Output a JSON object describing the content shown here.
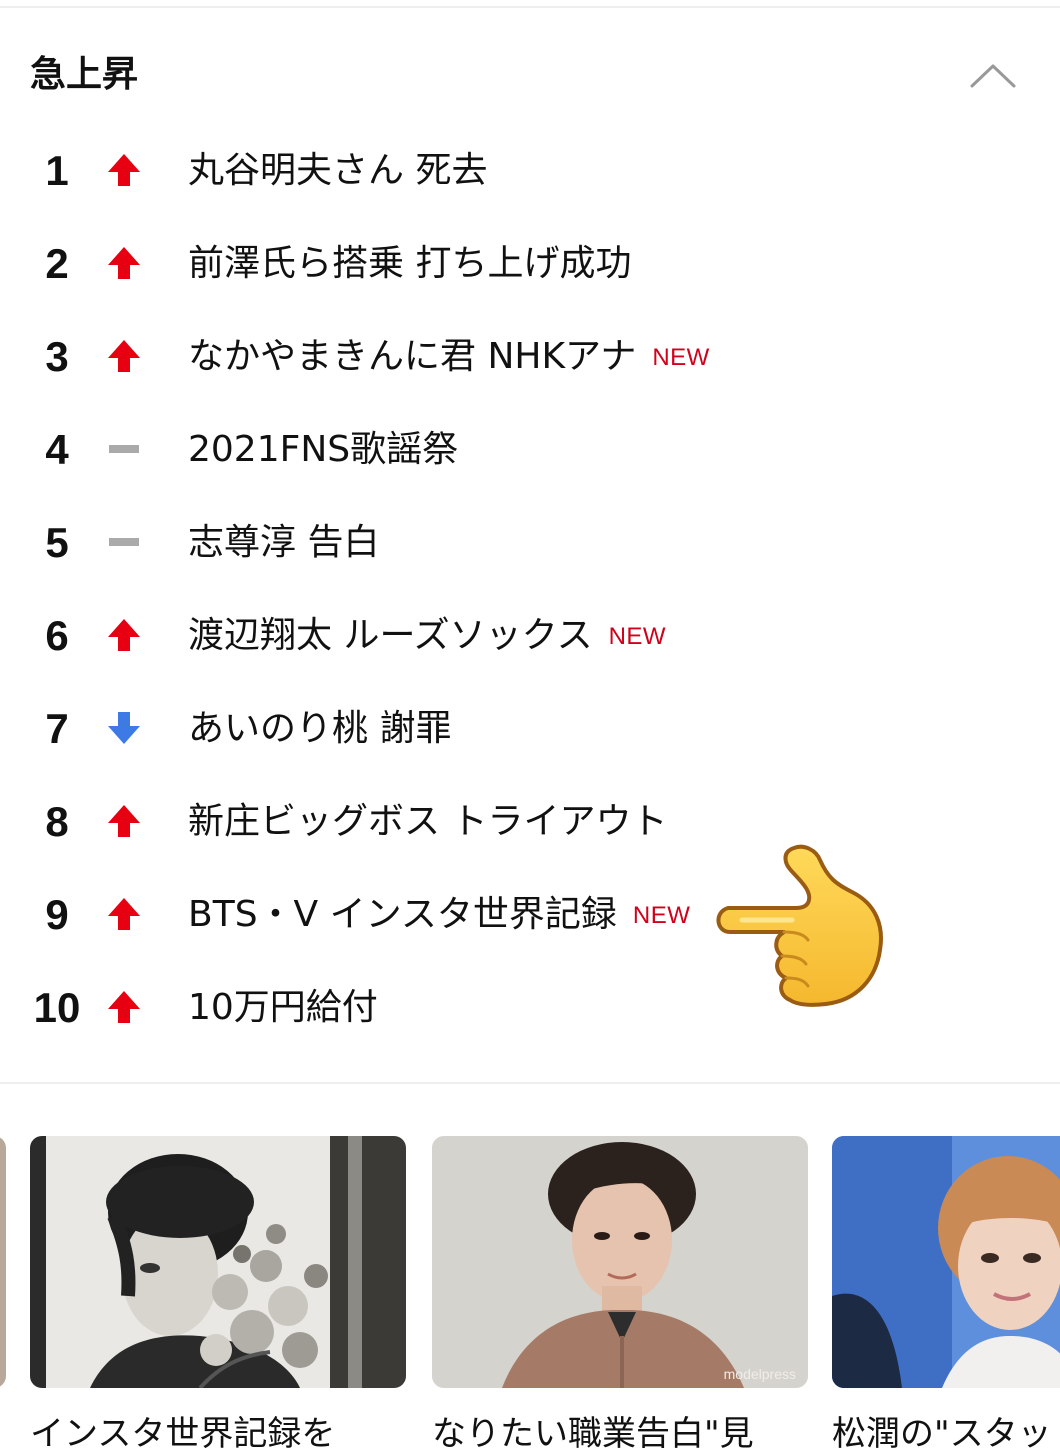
{
  "section": {
    "title": "急上昇"
  },
  "ranking": [
    {
      "rank": "1",
      "trend": "up",
      "text": "丸谷明夫さん 死去",
      "badge": ""
    },
    {
      "rank": "2",
      "trend": "up",
      "text": "前澤氏ら搭乗 打ち上げ成功",
      "badge": ""
    },
    {
      "rank": "3",
      "trend": "up",
      "text": "なかやまきんに君 NHKアナ",
      "badge": "NEW"
    },
    {
      "rank": "4",
      "trend": "same",
      "text": "2021FNS歌謡祭",
      "badge": ""
    },
    {
      "rank": "5",
      "trend": "same",
      "text": "志尊淳 告白",
      "badge": ""
    },
    {
      "rank": "6",
      "trend": "up",
      "text": "渡辺翔太 ルーズソックス",
      "badge": "NEW"
    },
    {
      "rank": "7",
      "trend": "down",
      "text": "あいのり桃 謝罪",
      "badge": ""
    },
    {
      "rank": "8",
      "trend": "up",
      "text": "新庄ビッグボス トライアウト",
      "badge": ""
    },
    {
      "rank": "9",
      "trend": "up",
      "text": "BTS・V インスタ世界記録",
      "badge": "NEW"
    },
    {
      "rank": "10",
      "trend": "up",
      "text": "10万円給付",
      "badge": ""
    }
  ],
  "cards": [
    {
      "caption": "インスタ世界記録を"
    },
    {
      "caption": "なりたい職業告白\"見",
      "watermark": "modelpress"
    },
    {
      "caption": "松潤の\"スタッ"
    }
  ],
  "colors": {
    "up": "#e60012",
    "down": "#3d7ae6",
    "same": "#aaaaaa",
    "new_badge": "#d0021b"
  },
  "icons": {
    "collapse": "chevron-up-icon",
    "up": "arrow-up-icon",
    "down": "arrow-down-icon",
    "same": "dash-icon",
    "hand": "pointing-left-hand-emoji"
  }
}
